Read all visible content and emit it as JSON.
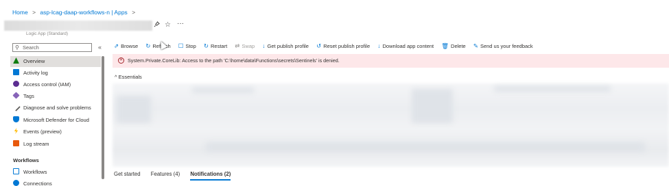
{
  "breadcrumb": {
    "home": "Home",
    "sep": ">",
    "resource": "asp-lcag-daap-workflows-n | Apps"
  },
  "subtitle": "Logic App (Standard)",
  "title_icons": {
    "pin": "☆",
    "star": "☆",
    "more": "···"
  },
  "sidebar": {
    "search_placeholder": "Search",
    "collapse": "«",
    "items": [
      {
        "label": "Overview",
        "color": "#107c10"
      },
      {
        "label": "Activity log",
        "color": "#0078d4"
      },
      {
        "label": "Access control (IAM)",
        "color": "#5c2d91"
      },
      {
        "label": "Tags",
        "color": "#8764b8"
      },
      {
        "label": "Diagnose and solve problems",
        "color": "#605e5c"
      },
      {
        "label": "Microsoft Defender for Cloud",
        "color": "#0078d4"
      },
      {
        "label": "Events (preview)",
        "color": "#ffb900"
      },
      {
        "label": "Log stream",
        "color": "#e8590c"
      }
    ],
    "section_workflows": "Workflows",
    "workflow_items": [
      {
        "label": "Workflows",
        "color": "#0078d4"
      },
      {
        "label": "Connections",
        "color": "#0078d4"
      }
    ]
  },
  "toolbar": {
    "browse": "Browse",
    "refresh": "Refresh",
    "stop": "Stop",
    "restart": "Restart",
    "swap": "Swap",
    "get_publish_profile": "Get publish profile",
    "reset_publish_profile": "Reset publish profile",
    "download_app_content": "Download app content",
    "delete": "Delete",
    "feedback": "Send us your feedback"
  },
  "error": {
    "message": "System.Private.CoreLib: Access to the path 'C:\\home\\data\\Functions\\secrets\\Sentinels' is denied."
  },
  "essentials": {
    "label": "Essentials"
  },
  "tabs": [
    {
      "label": "Get started"
    },
    {
      "label": "Features (4)"
    },
    {
      "label": "Notifications (2)"
    }
  ]
}
